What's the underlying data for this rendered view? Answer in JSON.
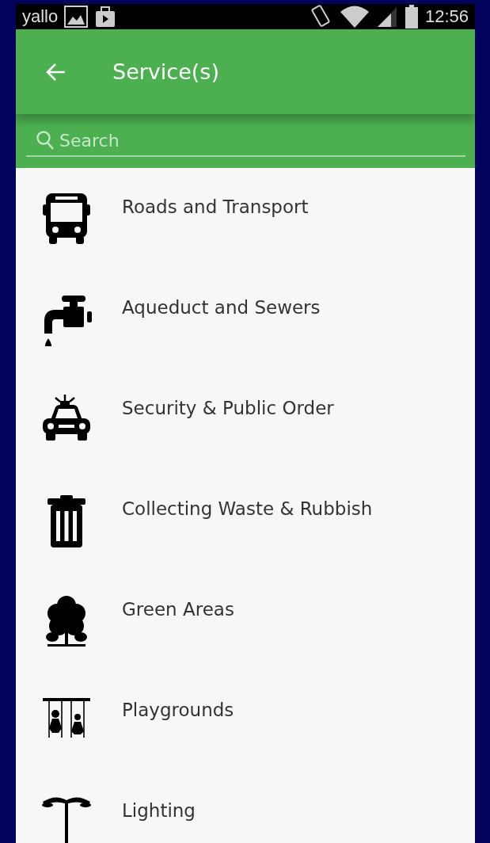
{
  "status_bar": {
    "carrier": "yallo",
    "time": "12:56"
  },
  "header": {
    "title": "Service(s)"
  },
  "search": {
    "placeholder": "Search"
  },
  "services": [
    {
      "kind": "bus",
      "label": "Roads and Transport"
    },
    {
      "kind": "tap",
      "label": "Aqueduct and Sewers"
    },
    {
      "kind": "police-car",
      "label": "Security & Public Order"
    },
    {
      "kind": "trash",
      "label": "Collecting Waste & Rubbish"
    },
    {
      "kind": "tree",
      "label": "Green Areas"
    },
    {
      "kind": "swing",
      "label": "Playgrounds"
    },
    {
      "kind": "lamp",
      "label": "Lighting"
    }
  ]
}
